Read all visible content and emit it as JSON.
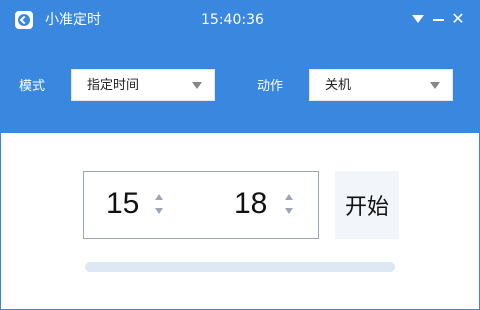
{
  "colors": {
    "accent": "#3a87e0",
    "progress_track": "#dde8f4"
  },
  "titlebar": {
    "app_icon": "clock-check-icon",
    "title": "小准定时",
    "clock": "15:40:36",
    "buttons": {
      "dropdown": "dropdown-icon",
      "minimize": "minimize-icon",
      "close": "✕"
    }
  },
  "toolbar": {
    "mode_label": "模式",
    "mode_value": "指定时间",
    "action_label": "动作",
    "action_value": "关机"
  },
  "timer": {
    "hour": "15",
    "minute": "18"
  },
  "start_label": "开始",
  "progress": {
    "value": 0
  }
}
